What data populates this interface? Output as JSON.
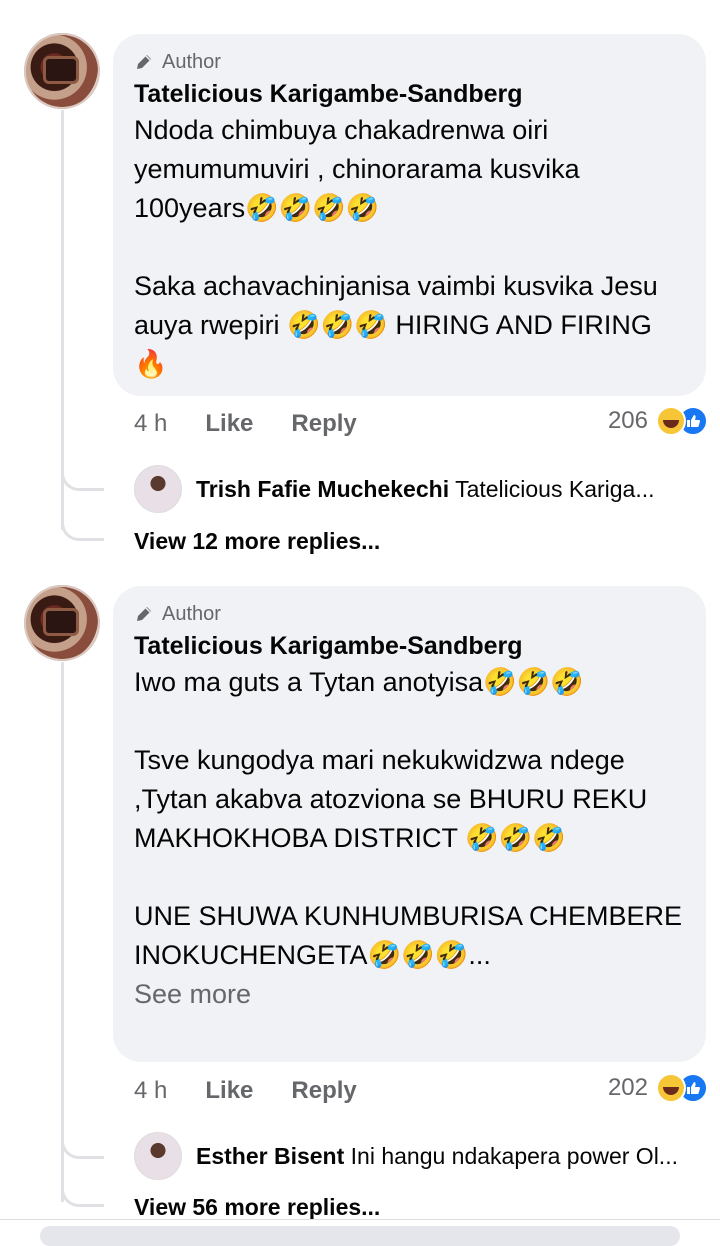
{
  "comments": [
    {
      "author_badge": "Author",
      "name": "Tatelicious Karigambe-Sandberg",
      "text": "Ndoda chimbuya chakadrenwa oiri yemumumuviri , chinorarama kusvika 100years🤣🤣🤣🤣\n\nSaka achavachinjanisa vaimbi kusvika Jesu auya rwepiri 🤣🤣🤣 HIRING AND FIRING 🔥",
      "see_more": "",
      "time": "4 h",
      "like": "Like",
      "reply": "Reply",
      "reaction_count": "206",
      "reply_preview": {
        "name": "Trish Fafie Muchekechi",
        "text": "Tatelicious Kariga..."
      },
      "view_more": "View 12 more replies..."
    },
    {
      "author_badge": "Author",
      "name": "Tatelicious Karigambe-Sandberg",
      "text": "Iwo ma guts a Tytan anotyisa🤣🤣🤣\n\nTsve kungodya mari nekukwidzwa ndege ,Tytan akabva atozviona se BHURU REKU MAKHOKHOBA DISTRICT 🤣🤣🤣\n\nUNE SHUWA KUNHUMBURISA CHEMBERE INOKUCHENGETA🤣🤣🤣...",
      "see_more": "See more",
      "time": "4 h",
      "like": "Like",
      "reply": "Reply",
      "reaction_count": "202",
      "reply_preview": {
        "name": "Esther Bisent",
        "text": "Ini hangu ndakapera power Ol..."
      },
      "view_more": "View 56 more replies..."
    }
  ],
  "icons": {
    "author": "pencil-icon",
    "reactions": [
      "haha-icon",
      "like-icon"
    ]
  },
  "colors": {
    "bubble": "#f0f2f5",
    "like_blue": "#1877f2",
    "muted": "#65676b"
  }
}
